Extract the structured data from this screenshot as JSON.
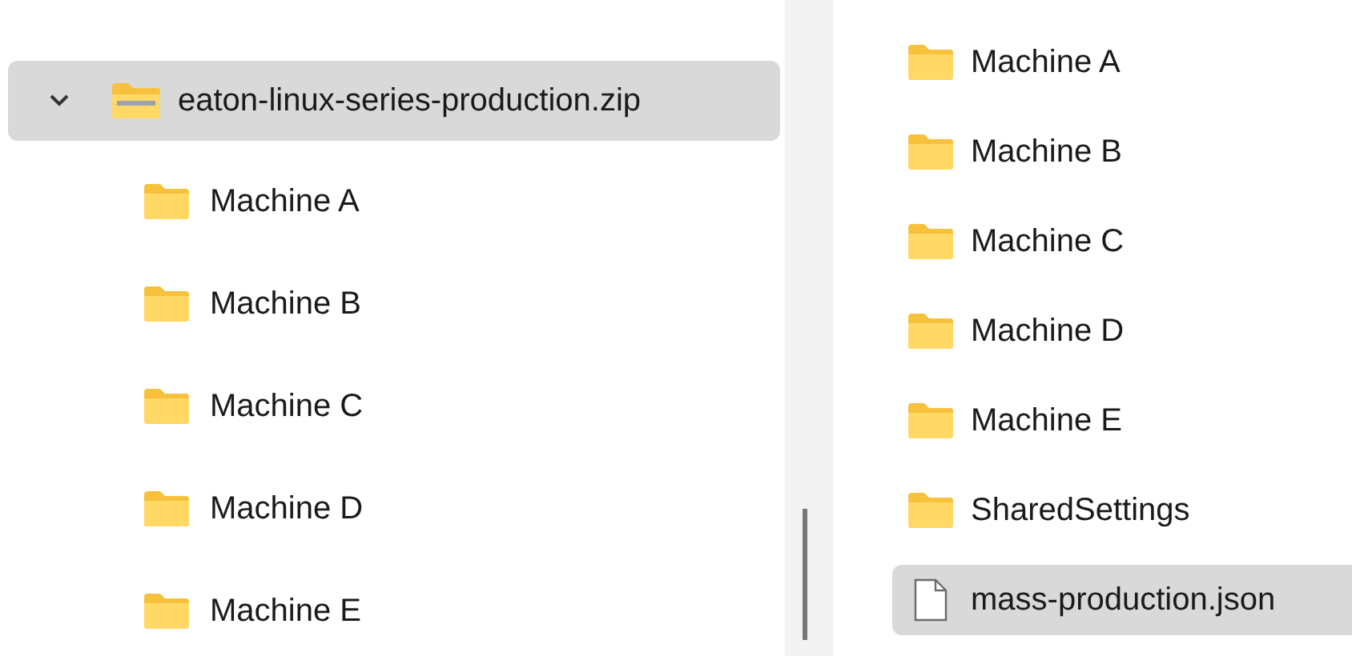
{
  "tree": {
    "label": "eaton-linux-series-production.zip",
    "kind": "zip",
    "expanded": true,
    "selected": true,
    "children": [
      {
        "label": "Machine A",
        "kind": "folder",
        "selected": false
      },
      {
        "label": "Machine B",
        "kind": "folder",
        "selected": false
      },
      {
        "label": "Machine C",
        "kind": "folder",
        "selected": false
      },
      {
        "label": "Machine D",
        "kind": "folder",
        "selected": false
      },
      {
        "label": "Machine E",
        "kind": "folder",
        "selected": false
      }
    ]
  },
  "items": [
    {
      "label": "Machine A",
      "kind": "folder",
      "selected": false
    },
    {
      "label": "Machine B",
      "kind": "folder",
      "selected": false
    },
    {
      "label": "Machine C",
      "kind": "folder",
      "selected": false
    },
    {
      "label": "Machine D",
      "kind": "folder",
      "selected": false
    },
    {
      "label": "Machine E",
      "kind": "folder",
      "selected": false
    },
    {
      "label": "SharedSettings",
      "kind": "folder",
      "selected": false
    },
    {
      "label": "mass-production.json",
      "kind": "file",
      "selected": true
    }
  ]
}
